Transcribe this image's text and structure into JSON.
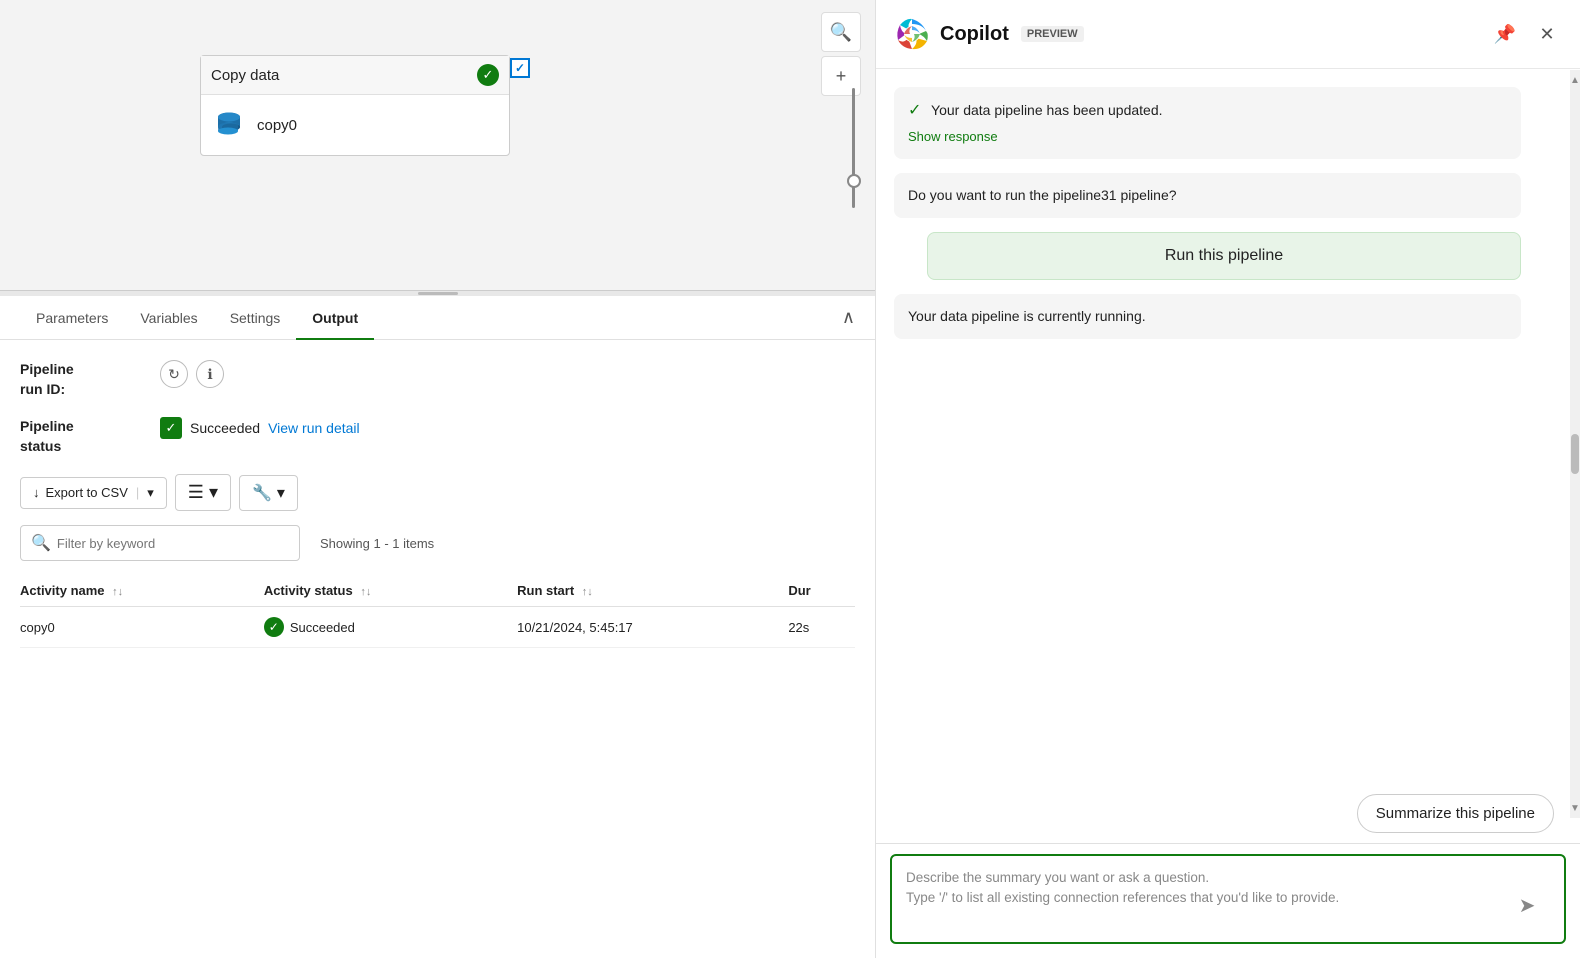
{
  "canvas": {
    "node": {
      "title": "Copy data",
      "item_name": "copy0"
    },
    "toolbar": {
      "search_icon": "🔍",
      "add_icon": "+"
    }
  },
  "tabs": {
    "items": [
      {
        "label": "Parameters",
        "active": false
      },
      {
        "label": "Variables",
        "active": false
      },
      {
        "label": "Settings",
        "active": false
      },
      {
        "label": "Output",
        "active": true
      }
    ],
    "collapse_icon": "∧"
  },
  "output": {
    "pipeline_run_id_label": "Pipeline\nrun ID:",
    "pipeline_status_label": "Pipeline\nstatus",
    "status_text": "Succeeded",
    "view_run_detail": "View run detail",
    "export_btn": "Export to CSV",
    "showing_text": "Showing 1 - 1 items",
    "search_placeholder": "Filter by keyword",
    "table": {
      "columns": [
        {
          "label": "Activity name"
        },
        {
          "label": "Activity status"
        },
        {
          "label": "Run start"
        },
        {
          "label": "Dur"
        }
      ],
      "rows": [
        {
          "activity_name": "copy0",
          "activity_status": "Succeeded",
          "run_start": "10/21/2024, 5:45:17",
          "duration": "22s"
        }
      ]
    }
  },
  "copilot": {
    "title": "Copilot",
    "preview_badge": "PREVIEW",
    "messages": [
      {
        "type": "assistant_status",
        "text": "Your data pipeline has been updated.",
        "show_response": "Show response"
      },
      {
        "type": "assistant",
        "text": "Do you want to run the pipeline31 pipeline?"
      },
      {
        "type": "user_btn",
        "text": "Run this pipeline"
      },
      {
        "type": "assistant",
        "text": "Your data pipeline is currently running."
      },
      {
        "type": "summarize_btn",
        "text": "Summarize this pipeline"
      }
    ],
    "input_placeholder": "Describe the summary you want or ask a question.\nType '/' to list all existing connection references that you'd like to provide."
  }
}
